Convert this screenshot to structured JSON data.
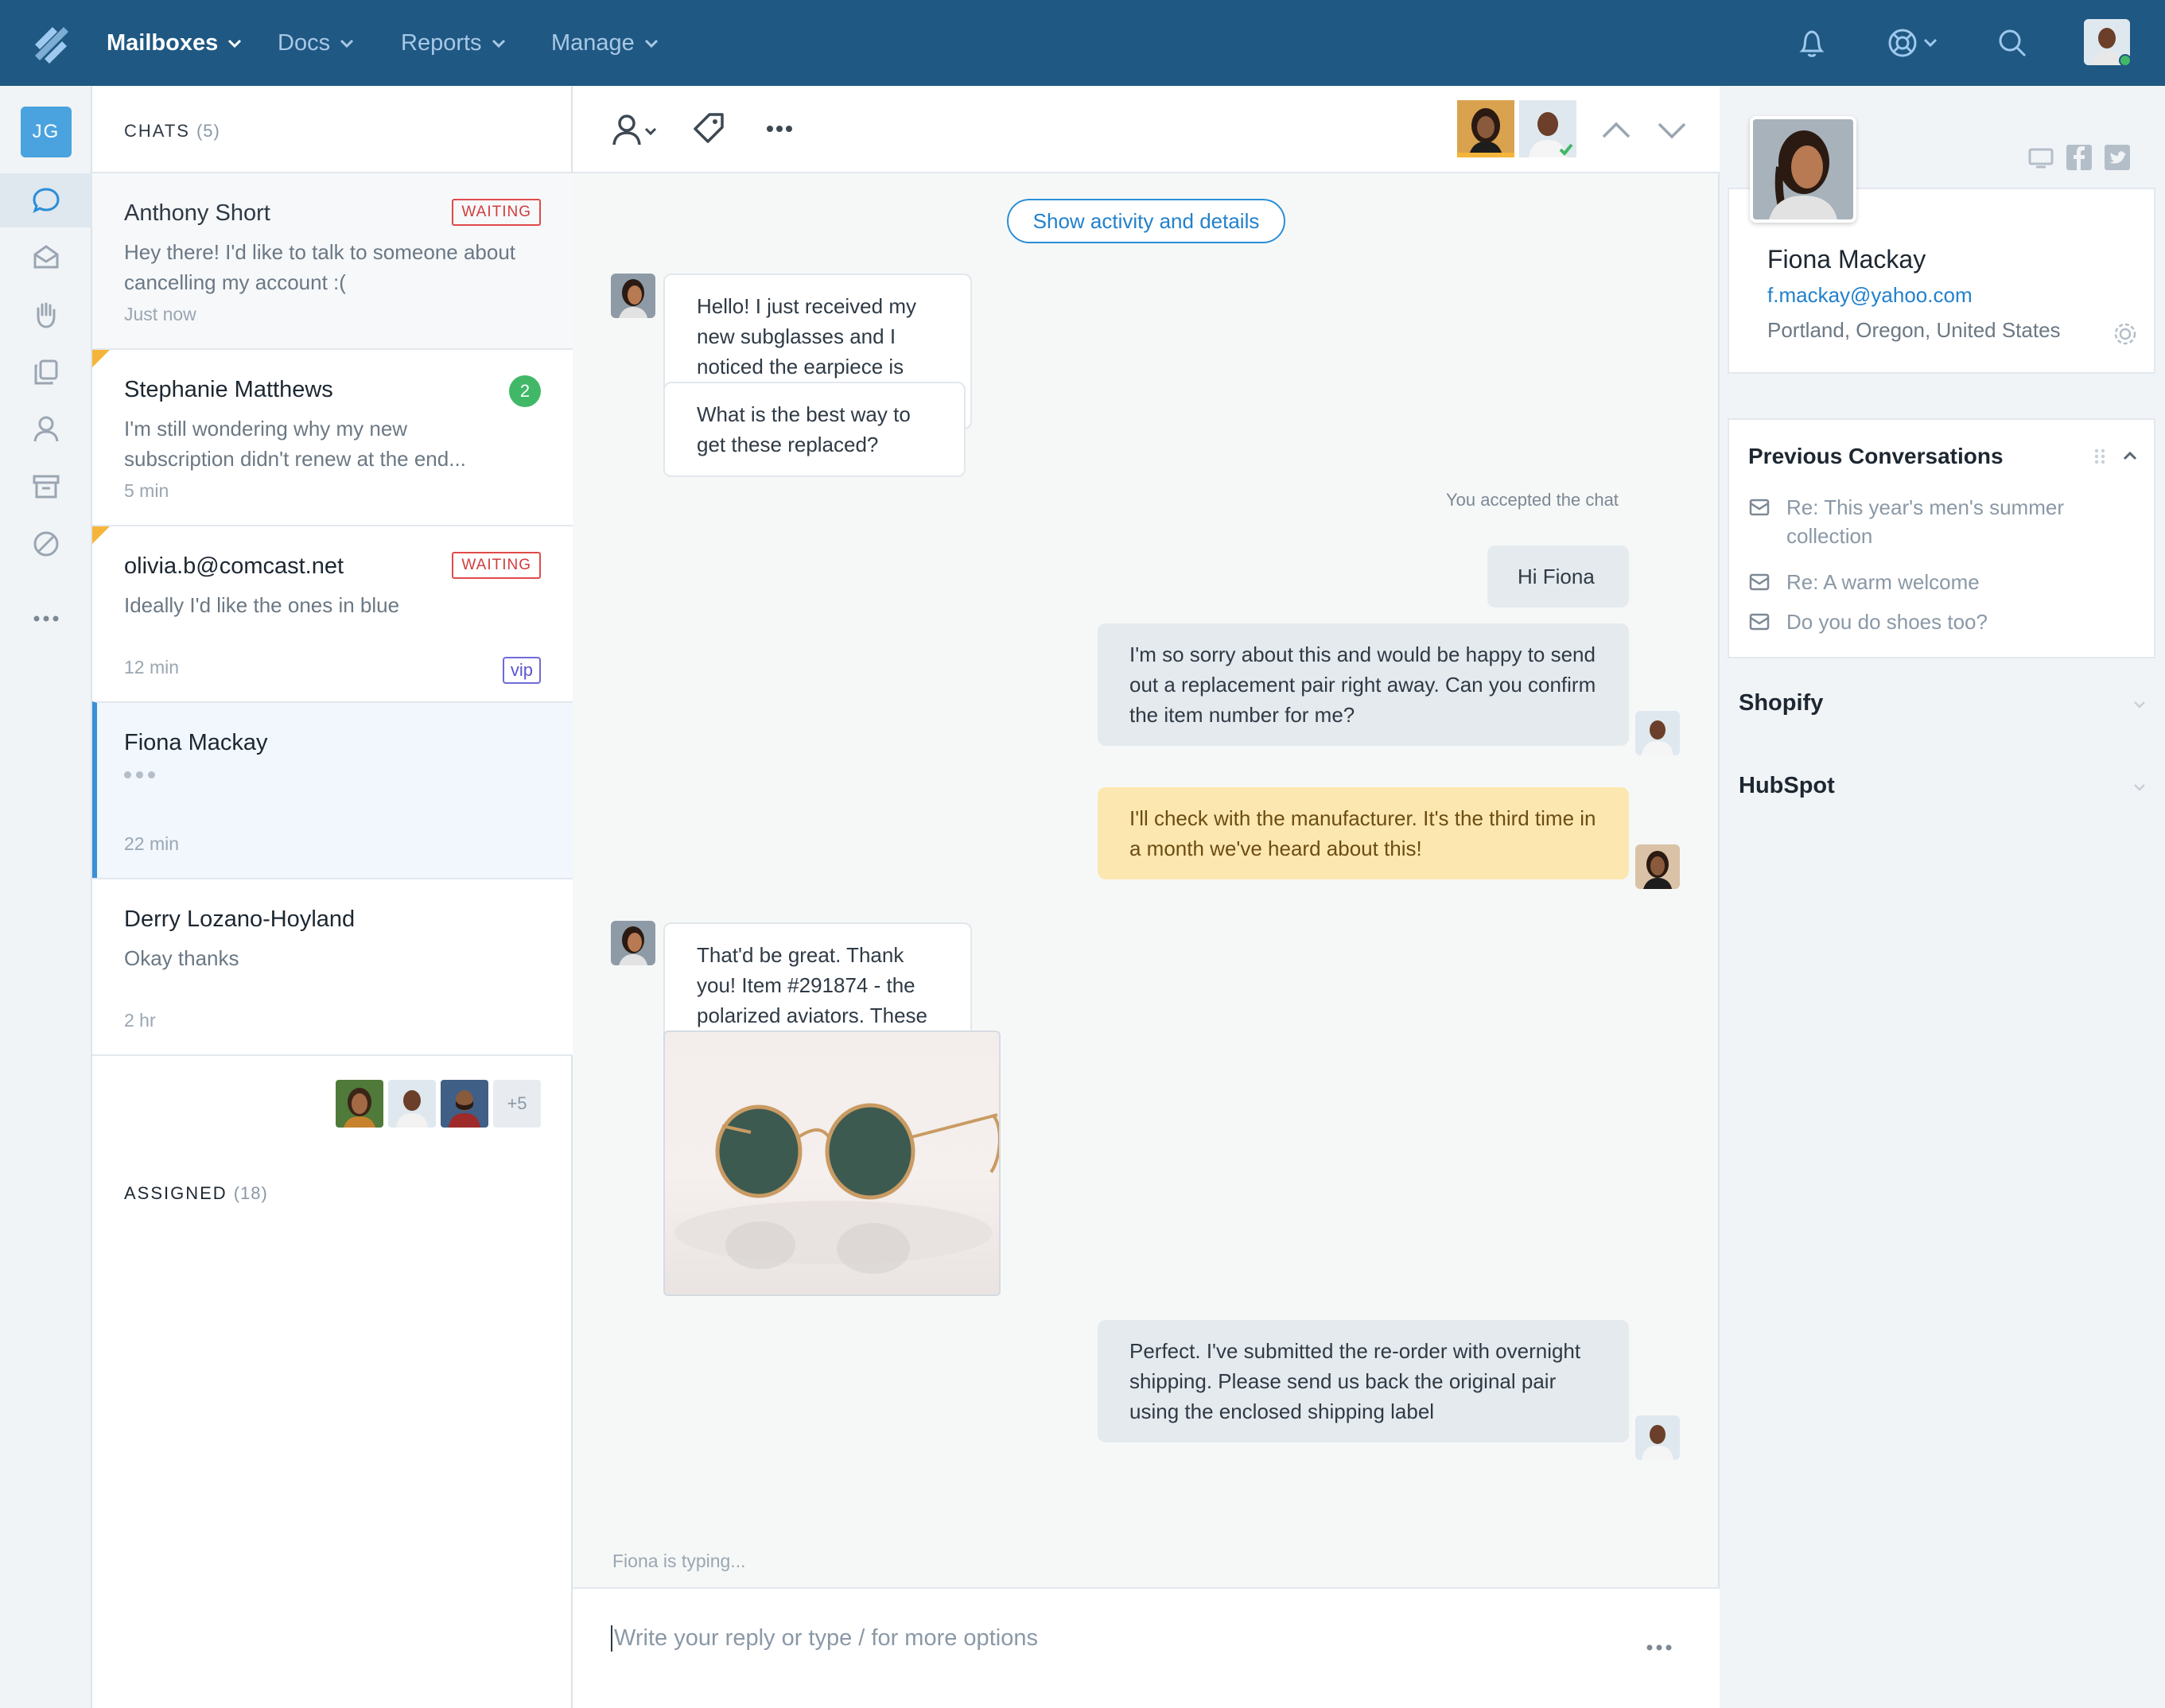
{
  "nav": {
    "items": [
      {
        "label": "Mailboxes",
        "active": true
      },
      {
        "label": "Docs",
        "active": false
      },
      {
        "label": "Reports",
        "active": false
      },
      {
        "label": "Manage",
        "active": false
      }
    ],
    "icons": [
      "bell-icon",
      "help-lifebuoy-icon",
      "search-icon",
      "user-avatar"
    ]
  },
  "rail": {
    "user_initials": "JG",
    "icons": [
      "chat-icon",
      "inbox-icon",
      "hand-icon",
      "copy-icon",
      "person-icon",
      "archive-icon",
      "blocked-icon",
      "more-icon"
    ]
  },
  "chat_list": {
    "header": "CHATS",
    "header_count": "(5)",
    "items": [
      {
        "name": "Anthony Short",
        "message": "Hey there! I'd like to talk to someone about cancelling my account :(",
        "time": "Just now",
        "badge": "WAITING"
      },
      {
        "name": "Stephanie Matthews",
        "message": "I'm still wondering why my new subscription didn't renew at the end...",
        "time": "5 min",
        "badge": "2"
      },
      {
        "name": "olivia.b@comcast.net",
        "message": "Ideally I'd like the ones in blue",
        "time": "12 min",
        "badge": "WAITING",
        "tag": "vip"
      },
      {
        "name": "Fiona Mackay",
        "message": "",
        "time": "22 min"
      },
      {
        "name": "Derry Lozano-Hoyland",
        "message": "Okay thanks",
        "time": "2 hr"
      }
    ],
    "assigned_label": "ASSIGNED",
    "assigned_count": "(18)",
    "assigned_more": "+5"
  },
  "conversation": {
    "show_activity_button": "Show activity and details",
    "messages": [
      {
        "from": "customer",
        "text": "Hello! I just received my new subglasses and I noticed the earpiece is broken"
      },
      {
        "from": "customer",
        "text": "What is the best way to get these replaced?"
      },
      {
        "from": "system",
        "text": "You accepted the chat"
      },
      {
        "from": "agent",
        "text": "Hi Fiona"
      },
      {
        "from": "agent",
        "text": "I'm so sorry about this and would be happy to send out a replacement pair right away. Can you confirm the item number for me?"
      },
      {
        "from": "note",
        "text": "I'll check with the manufacturer. It's the third time in a month we've heard about this!"
      },
      {
        "from": "customer",
        "text": "That'd be great. Thank you! Item #291874 - the polarized aviators. These ones:"
      },
      {
        "from": "agent",
        "text": "Perfect. I've submitted the re-order with overnight shipping. Please send us back the original pair using the enclosed shipping label"
      }
    ],
    "typing_indicator": "Fiona is typing...",
    "reply_placeholder": "Write your reply or type / for more options"
  },
  "customer": {
    "name": "Fiona Mackay",
    "email": "f.mackay@yahoo.com",
    "location": "Portland, Oregon, United States",
    "previous_title": "Previous Conversations",
    "previous": [
      "Re: This year's men's summer collection",
      "Re: A warm welcome",
      "Do you do shoes too?"
    ],
    "apps": [
      "Shopify",
      "HubSpot"
    ]
  },
  "colors": {
    "topbar": "#1f5882",
    "accent": "#2281cc",
    "waiting": "#d23c3c",
    "unread": "#41b868",
    "vip": "#5b55cf",
    "note": "#fde7b1"
  }
}
